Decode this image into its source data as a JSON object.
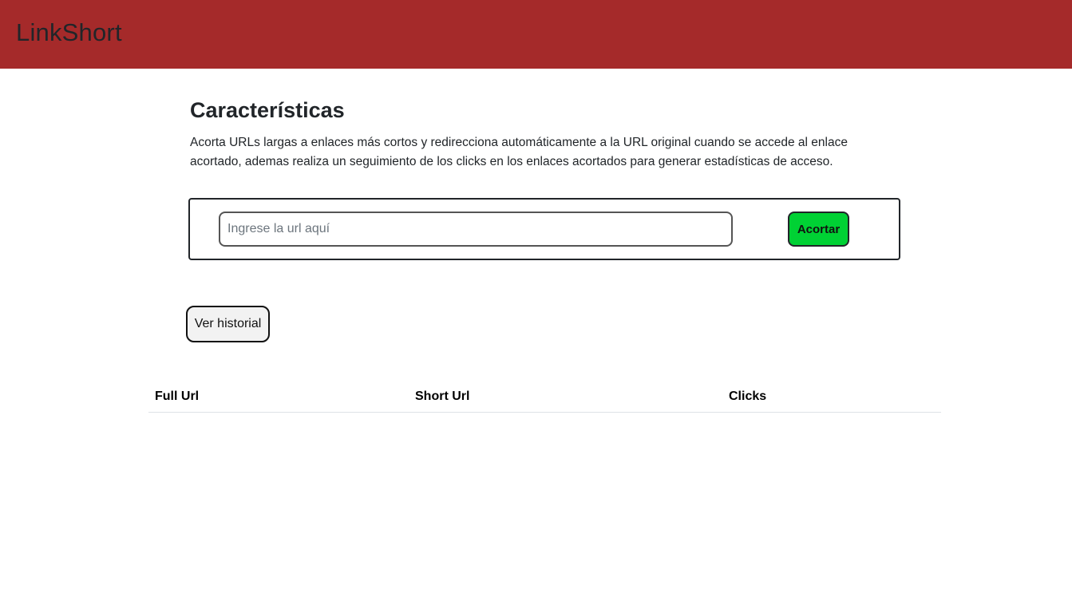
{
  "header": {
    "brand": "LinkShort",
    "background_color": "#a52a2a"
  },
  "features": {
    "title": "Características",
    "description": "Acorta URLs largas a enlaces más cortos y redirecciona automáticamente a la URL original cuando se accede al enlace acortado, ademas realiza un seguimiento de los clicks en los enlaces acortados para generar estadísticas de acceso."
  },
  "shortener_form": {
    "url_input": {
      "value": "",
      "placeholder": "Ingrese la url aquí"
    },
    "submit_label": "Acortar",
    "submit_color": "#00d134"
  },
  "history": {
    "button_label": "Ver historial",
    "table": {
      "columns": [
        "Full Url",
        "Short Url",
        "Clicks"
      ],
      "rows": []
    }
  }
}
